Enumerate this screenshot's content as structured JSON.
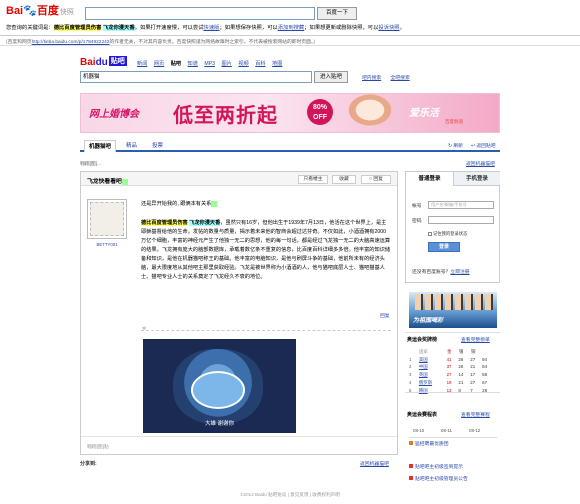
{
  "snapshot": {
    "logo_main": "Bai",
    "logo_du": "du",
    "logo_cn": "百度",
    "logo_suffix": "快照",
    "search_value": "",
    "search_button": "百度一下",
    "line1_prefix": "您查询的关键词是：",
    "kw1": "德比百度管理员伤害",
    "kw2": "飞龙你漫天香",
    "line1_mid": "。如果打开速度慢，可以尝试",
    "link_fast": "快速版",
    "line1_mid2": "；如果想保存快照，可以",
    "link_fav": "添加到搜藏",
    "line1_mid3": "；如果想更新或删除快照，可以",
    "link_report": "投诉快照",
    "line1_end": "。",
    "line2_prefix": "(百度和网页",
    "line2_url": "http://tieba.baidu.com/p/1784922242",
    "line2_suffix": "的作者无关，不对其内容负责。百度快照谨为网络故障时之索引，不代表被搜索网站的即时页面。)"
  },
  "tieba": {
    "logo_bai": "Bai",
    "logo_du": "du",
    "logo_suffix": "贴吧",
    "nav": [
      "新闻",
      "网页",
      "贴吧",
      "知道",
      "MP3",
      "图片",
      "视频",
      "百科",
      "地图"
    ],
    "nav_current_index": 2,
    "search_value": "机器猫",
    "search_button": "进入贴吧",
    "tool1": "吧内搜索",
    "tool2": "全吧搜索"
  },
  "banner": {
    "text1": "网上婚博会",
    "text2": "低至两折起",
    "badge_top": "80%",
    "badge_bottom": "OFF",
    "brand": "爱乐活",
    "brand_sub": "百度频道"
  },
  "forum": {
    "tabs": [
      "机器猫吧",
      "精品",
      "投票"
    ],
    "refresh": "刷新",
    "back": "返回贴吧",
    "crumb": "翱翔[图]...",
    "back_to_forum": "返回机器猫吧"
  },
  "post": {
    "title": "飞龙快看看吧",
    "title_hl": "",
    "btn_only_author": "只看楼主",
    "btn_fav": "收藏",
    "btn_reply": "回复",
    "author": "BETTY001",
    "line1": "还是异开始我的, 跟俩本有关系",
    "kw1": "德比百度管理员伤害",
    "kw2": "飞龙你漫天香",
    "body": "，虽然只有16岁，但他出生于1939年7月13日，他活在这个世界上，是主耶稣基督给他的生命。发帖的数量与质量，揭示着未来他的智商会超过达芬奇。不仅如此，小酒酒拥有2000万亿个细胞，丰富的神经元产生了他独一无二的思想，他的每一句话，都是经过飞龙独一无二的大脑高速运算的结果。飞龙拥有庞大的脑部数据库，承载着数亿条不重复的信息，比百度百科详细多多倍。他丰富的知识储备和知识，是他在机器猫吧称王的基础。他丰富的电脑知识，是他与刷屏斗争的基础，他前所未有的经济头脑，最大限度地从其他吧主那里获取经验。飞龙是被世界称为小酒酒的人，他与猫吧底层人士、猫吧猫基人士、猫吧专业人士的关系奠定了飞龙经久不衰的地位。",
    "reply_link": "回复",
    "caption": "大雄  谢谢你",
    "foot_reply": "翱翔[图]贴"
  },
  "bottom": {
    "share": "分享到:",
    "back": "返回机器猫吧"
  },
  "sidebar": {
    "tab_login": "普通登录",
    "tab_phone": "手机登录",
    "label_account": "帐号",
    "placeholder_account": "用户名/邮箱/手机号",
    "label_password": "密码",
    "remember": "记住我的登录状态",
    "login_button": "登录",
    "reg_prefix": "还没有百度账号？",
    "reg_link": "立即注册",
    "ad_text": "为祖国喝彩",
    "medal_title": "奥运会奖牌榜",
    "medal_more": "查看完整榜单",
    "medal_header": [
      "",
      "国家",
      "金",
      "银",
      "铜"
    ],
    "medals": [
      {
        "rank": "1",
        "country": "美国",
        "g": "41",
        "s": "26",
        "b": "27",
        "extra": "94"
      },
      {
        "rank": "2",
        "country": "中国",
        "g": "37",
        "s": "26",
        "b": "21",
        "extra": "84"
      },
      {
        "rank": "3",
        "country": "英国",
        "g": "27",
        "s": "14",
        "b": "17",
        "extra": "58"
      },
      {
        "rank": "4",
        "country": "俄罗斯",
        "g": "19",
        "s": "21",
        "b": "27",
        "extra": "67"
      },
      {
        "rank": "5",
        "country": "韩国",
        "g": "13",
        "s": "8",
        "b": "7",
        "extra": "28"
      }
    ],
    "schedule_title": "奥运会赛程表",
    "schedule_more": "查看完整赛程",
    "week": [
      "08-10",
      "08-11",
      "08-12"
    ],
    "schedule_item": "猛招聘最优质团",
    "link1": "贴吧吧主初级签到提示",
    "link2": "贴吧吧主初级管理员公告"
  },
  "footer": "©2012 Baidu 贴吧协议 | 意见反馈 | 收费权利声明",
  "colors": {
    "link": "#2a4aa8",
    "banner_pink": "#d4145a",
    "tab_blue": "#2a5db0"
  }
}
